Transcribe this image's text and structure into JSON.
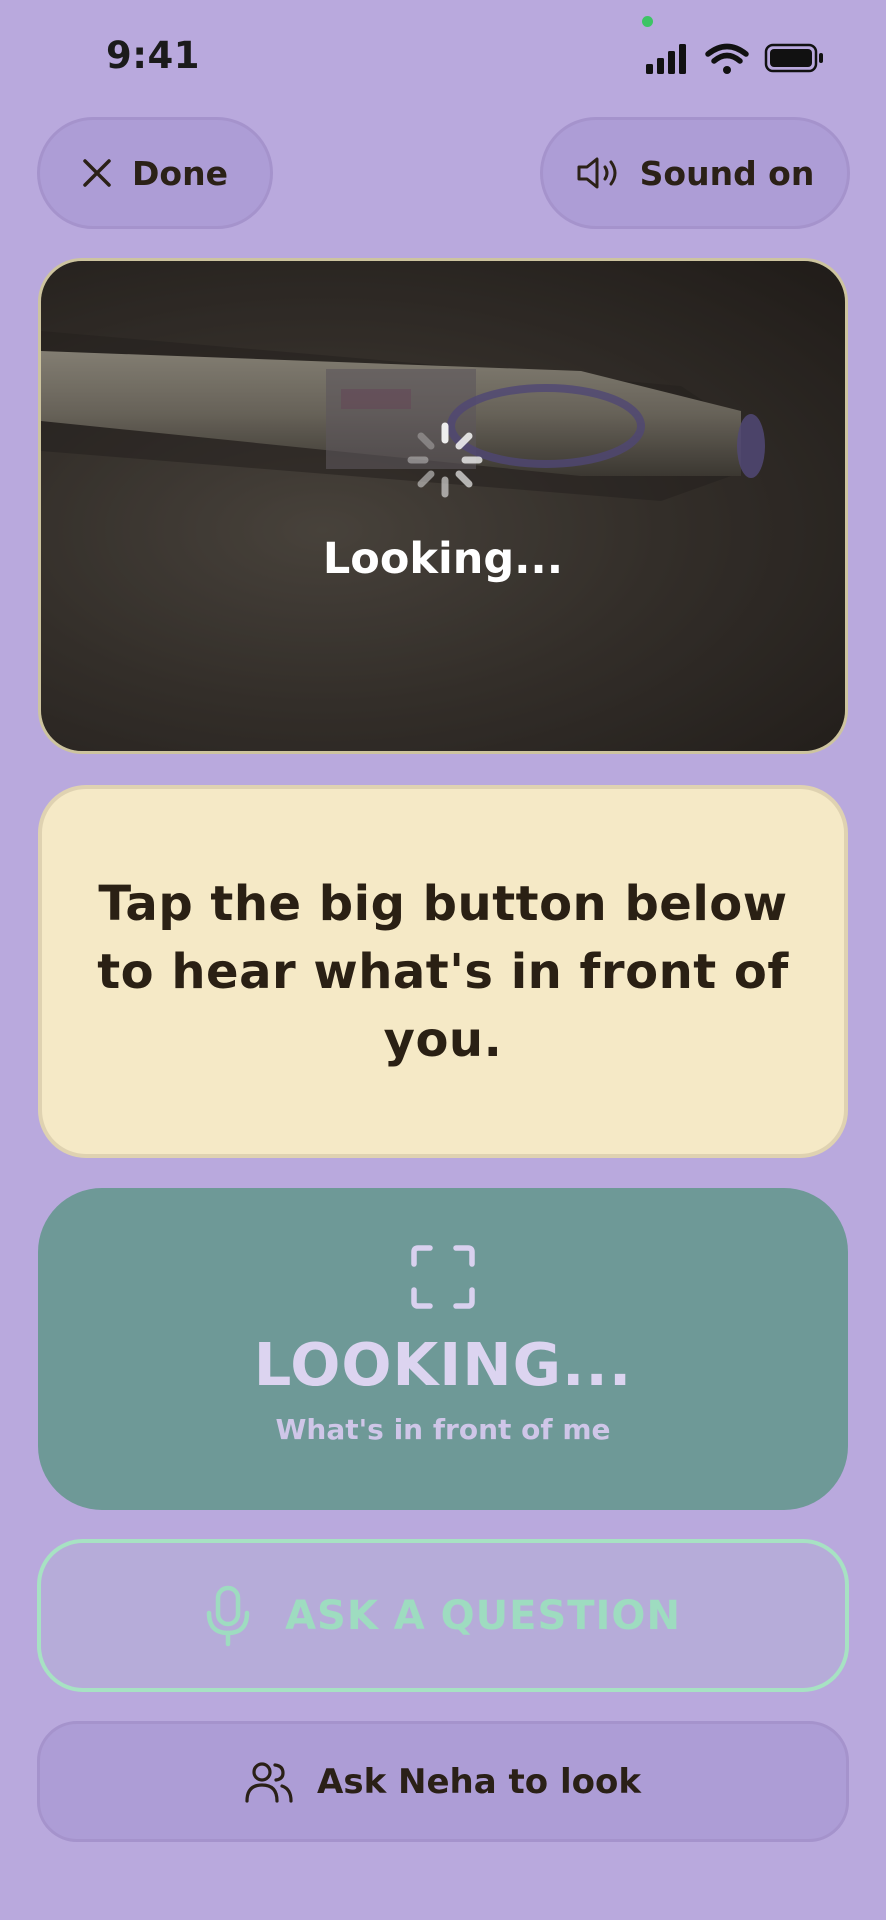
{
  "status_bar": {
    "time": "9:41"
  },
  "top_bar": {
    "done_label": "Done",
    "sound_label": "Sound on"
  },
  "camera": {
    "status_label": "Looking..."
  },
  "instruction": {
    "text": "Tap the big button below to hear what's in front of you."
  },
  "main_button": {
    "title": "LOOKING...",
    "subtitle": "What's in front of me"
  },
  "ask_question": {
    "label": "ASK A QUESTION"
  },
  "ask_helper": {
    "label": "Ask Neha to look"
  },
  "colors": {
    "background": "#b9a9dd",
    "instruction_card": "#f5e9c6",
    "main_button": "#6e9997",
    "ask_question_accent": "#9edcc0"
  },
  "icons": {
    "done": "close-icon",
    "sound": "speaker-icon",
    "loading": "spinner-icon",
    "scan": "scan-frame-icon",
    "mic": "microphone-icon",
    "people": "people-icon"
  }
}
